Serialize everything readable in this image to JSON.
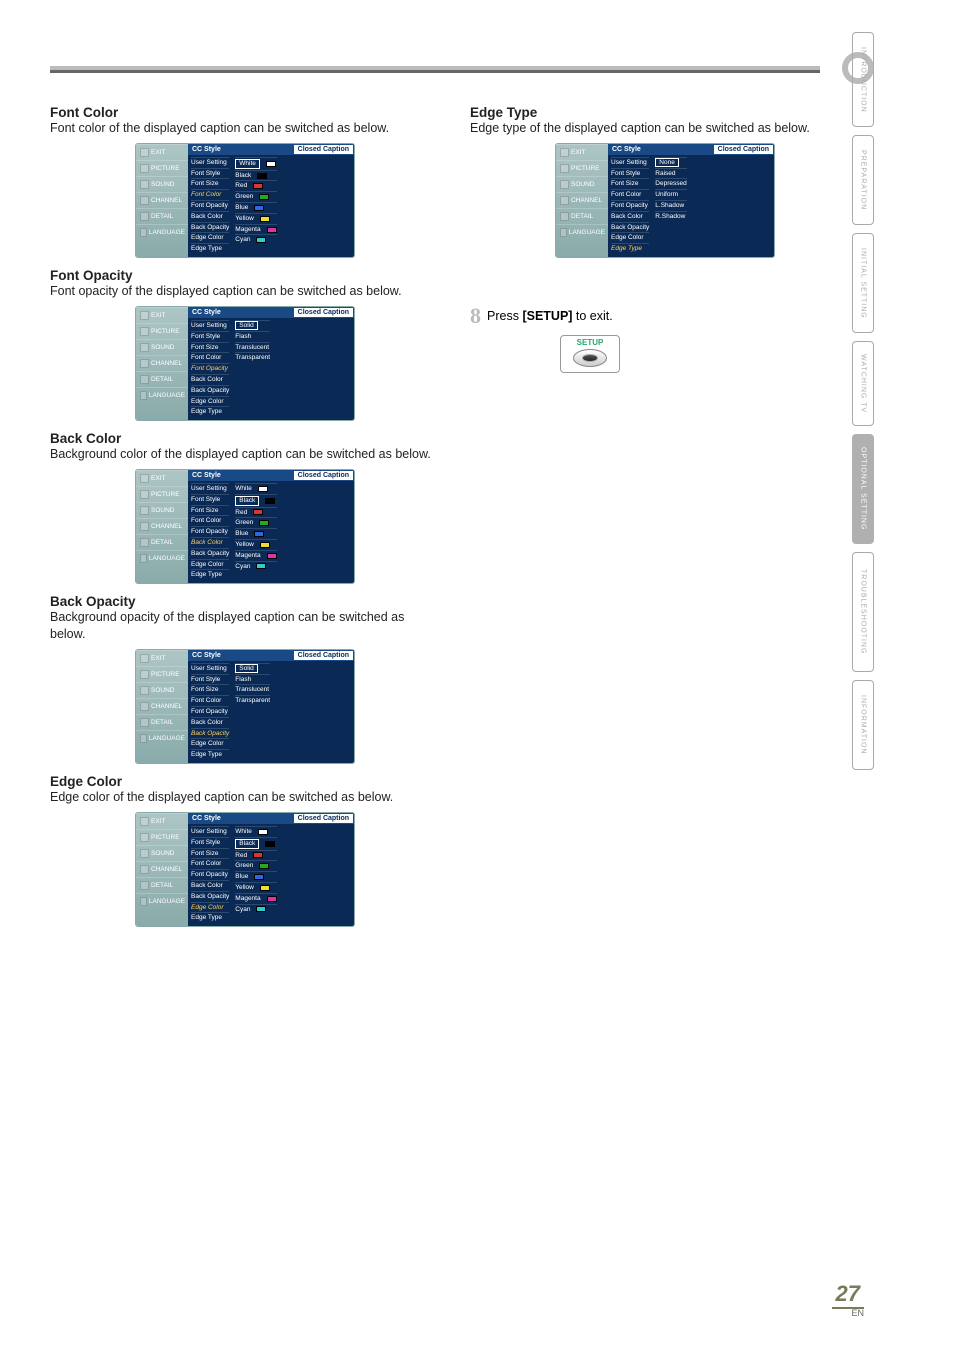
{
  "sideTabs": {
    "introduction": "INTRODUCTION",
    "preparation": "PREPARATION",
    "initialSetting": "INITIAL SETTING",
    "watchingTv": "WATCHING TV",
    "optionalSetting": "OPTIONAL SETTING",
    "troubleshooting": "TROUBLESHOOTING",
    "information": "INFORMATION"
  },
  "navItems": {
    "exit": "EXIT",
    "picture": "PICTURE",
    "sound": "SOUND",
    "channel": "CHANNEL",
    "detail": "DETAIL",
    "language": "LANGUAGE"
  },
  "menuTitleRow": {
    "ccStyle": "CC Style",
    "closedCaption": "Closed Caption"
  },
  "settingItems": {
    "userSetting": "User Setting",
    "fontStyle": "Font Style",
    "fontSize": "Font Size",
    "fontColor": "Font Color",
    "fontOpacity": "Font Opacity",
    "backColor": "Back Color",
    "backOpacity": "Back Opacity",
    "edgeColor": "Edge Color",
    "edgeType": "Edge Type"
  },
  "colorOptions": {
    "white": "White",
    "black": "Black",
    "red": "Red",
    "green": "Green",
    "blue": "Blue",
    "yellow": "Yellow",
    "magenta": "Magenta",
    "cyan": "Cyan"
  },
  "opacityOptions": {
    "solid": "Solid",
    "flash": "Flash",
    "translucent": "Translucent",
    "transparent": "Transparent"
  },
  "edgeTypeOptions": {
    "none": "None",
    "raised": "Raised",
    "depressed": "Depressed",
    "uniform": "Uniform",
    "lshadow": "L.Shadow",
    "rshadow": "R.Shadow"
  },
  "sections": {
    "fontColor": {
      "heading": "Font Color",
      "desc": "Font color of the displayed caption can be switched as below."
    },
    "fontOpacity": {
      "heading": "Font Opacity",
      "desc": "Font opacity of the displayed caption can be switched as below."
    },
    "backColor": {
      "heading": "Back Color",
      "desc": "Background color of the displayed caption can be switched as below."
    },
    "backOpacity": {
      "heading": "Back Opacity",
      "desc": "Background opacity of the displayed caption can be switched as below."
    },
    "edgeColor": {
      "heading": "Edge Color",
      "desc": "Edge color of the displayed caption can be switched as below."
    },
    "edgeType": {
      "heading": "Edge Type",
      "desc": "Edge type of the displayed caption can be switched as below."
    }
  },
  "step8": {
    "num": "8",
    "textPrefix": "Press ",
    "bold": "[SETUP]",
    "textSuffix": " to exit.",
    "label": "SETUP"
  },
  "pageNumber": {
    "num": "27",
    "lang": "EN"
  }
}
